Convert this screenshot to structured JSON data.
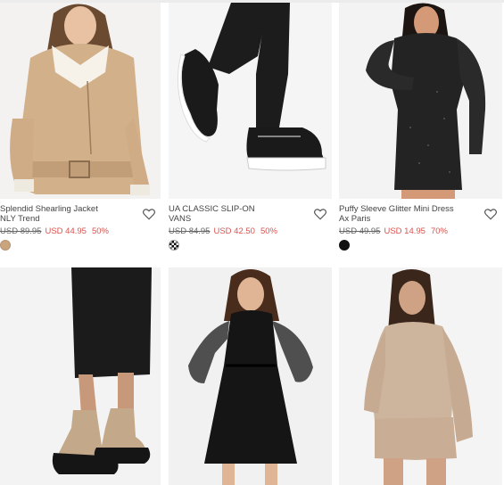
{
  "products": [
    {
      "name": "Splendid Shearling Jacket",
      "brand": "NLY Trend",
      "old_price": "USD 89.95",
      "new_price": "USD 44.95",
      "discount": "50%",
      "swatch": "#c9a57e",
      "wishlist_icon": "heart-icon"
    },
    {
      "name": "UA CLASSIC SLIP-ON",
      "brand": "VANS",
      "old_price": "USD 84.95",
      "new_price": "USD 42.50",
      "discount": "50%",
      "swatch": "checkerboard",
      "wishlist_icon": "heart-icon"
    },
    {
      "name": "Puffy Sleeve Glitter Mini Dress",
      "brand": "Ax Paris",
      "old_price": "USD 49.95",
      "new_price": "USD 14.95",
      "discount": "70%",
      "swatch": "#111111",
      "wishlist_icon": "heart-icon"
    },
    {
      "image": "sock-sneaker-boots"
    },
    {
      "image": "black-chiffon-dress"
    },
    {
      "image": "beige-sweatshirt-set"
    }
  ],
  "colors": {
    "sale": "#d9534f",
    "text": "#444444",
    "strike": "#666666"
  }
}
